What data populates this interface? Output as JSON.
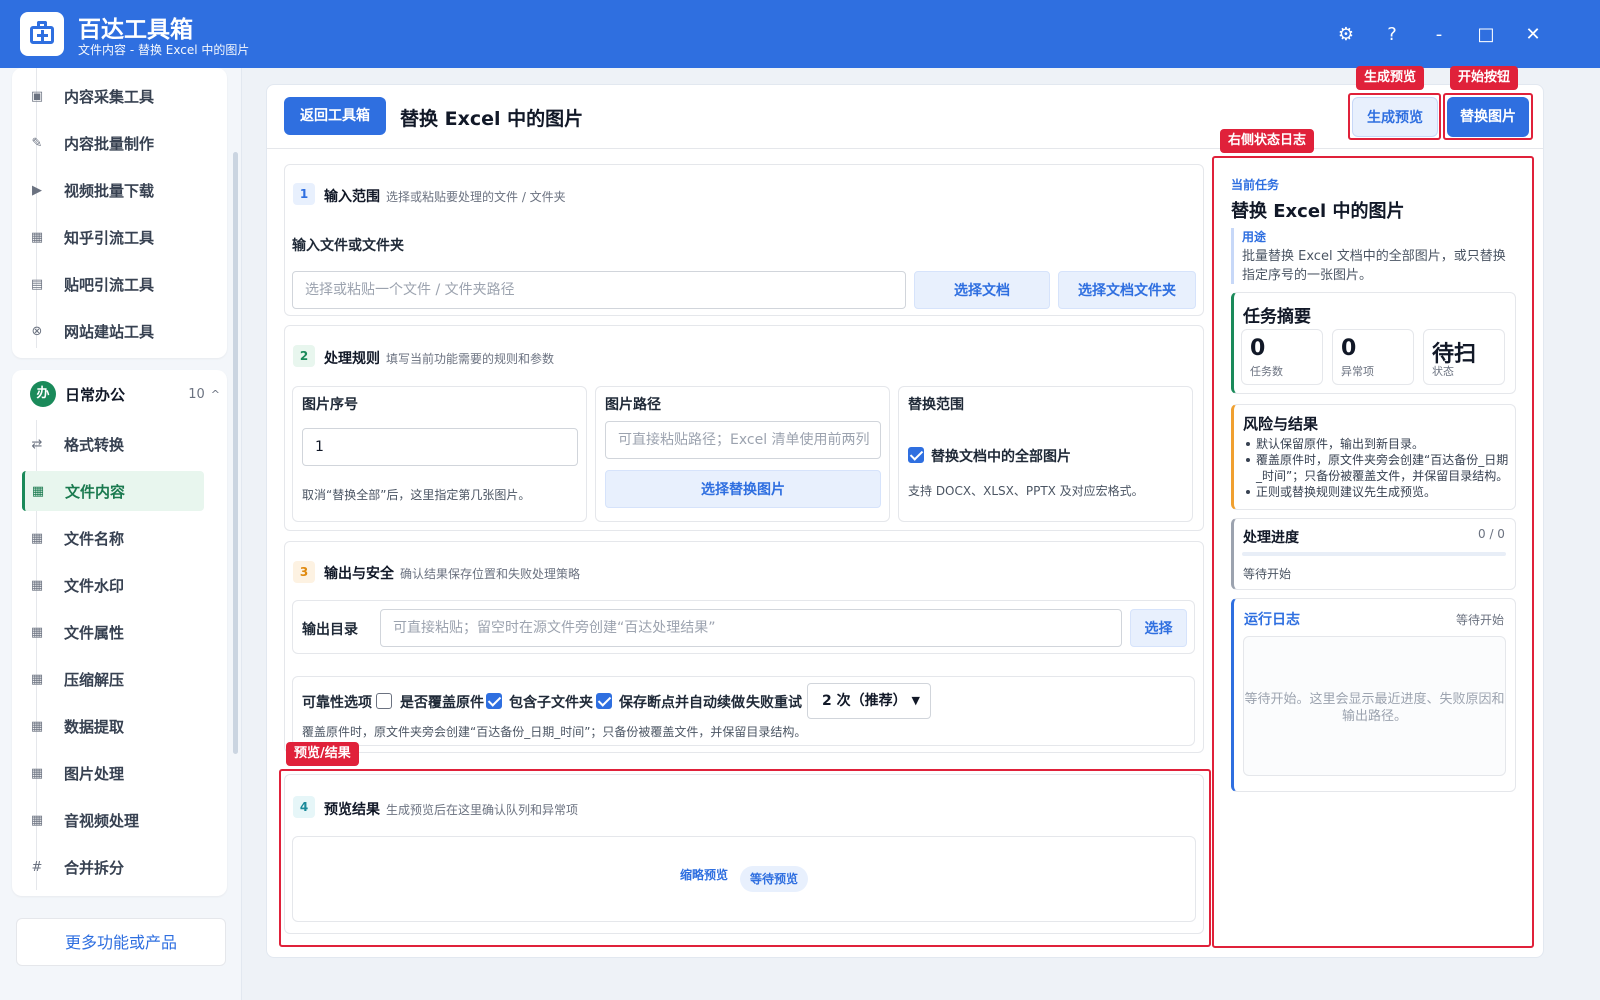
{
  "app": {
    "title": "百达工具箱",
    "subtitle": "文件内容 - 替换 Excel 中的图片",
    "window_buttons": {
      "settings": "⚙",
      "help": "?",
      "minimize": "-",
      "maximize": "□",
      "close": "✕"
    }
  },
  "sidebar": {
    "top_items": [
      {
        "label": "内容采集工具",
        "icon": "▣"
      },
      {
        "label": "内容批量制作",
        "icon": "✎"
      },
      {
        "label": "视频批量下载",
        "icon": "▶"
      },
      {
        "label": "知乎引流工具",
        "icon": "▦"
      },
      {
        "label": "贴吧引流工具",
        "icon": "▤"
      },
      {
        "label": "网站建站工具",
        "icon": "⊗"
      }
    ],
    "group": {
      "badge": "办",
      "name": "日常办公",
      "count": "10",
      "caret": "^"
    },
    "group_items": [
      {
        "label": "格式转换",
        "icon": "⇄"
      },
      {
        "label": "文件内容",
        "icon": "▦",
        "active": true
      },
      {
        "label": "文件名称",
        "icon": "▦"
      },
      {
        "label": "文件水印",
        "icon": "▦"
      },
      {
        "label": "文件属性",
        "icon": "▦"
      },
      {
        "label": "压缩解压",
        "icon": "▦"
      },
      {
        "label": "数据提取",
        "icon": "▦"
      },
      {
        "label": "图片处理",
        "icon": "▦"
      },
      {
        "label": "音视频处理",
        "icon": "▦"
      },
      {
        "label": "合并拆分",
        "icon": "#"
      }
    ],
    "more_label": "更多功能或产品"
  },
  "header": {
    "back_label": "返回工具箱",
    "title": "替换 Excel 中的图片",
    "preview_label": "生成预览",
    "start_label": "替换图片"
  },
  "section1": {
    "num": "1",
    "title": "输入范围",
    "desc": "选择或粘贴要处理的文件 / 文件夹",
    "field_label": "输入文件或文件夹",
    "placeholder": "选择或粘贴一个文件 / 文件夹路径",
    "btn_doc": "选择文档",
    "btn_folder": "选择文档文件夹"
  },
  "section2": {
    "num": "2",
    "title": "处理规则",
    "desc": "填写当前功能需要的规则和参数",
    "index_label": "图片序号",
    "index_value": "1",
    "index_hint": "取消“替换全部”后，这里指定第几张图片。",
    "path_label": "图片路径",
    "path_placeholder": "可直接粘贴路径；Excel 清单使用前两列",
    "path_button": "选择替换图片",
    "scope_label": "替换范围",
    "scope_checkbox": "替换文档中的全部图片",
    "scope_hint": "支持 DOCX、XLSX、PPTX 及对应宏格式。"
  },
  "section3": {
    "num": "3",
    "title": "输出与安全",
    "desc": "确认结果保存位置和失败处理策略",
    "output_label": "输出目录",
    "output_placeholder": "可直接粘贴；留空时在源文件旁创建“百达处理结果”",
    "output_button": "选择",
    "reliability_label": "可靠性选项",
    "opt_overwrite": "是否覆盖原件",
    "opt_subfolders": "包含子文件夹",
    "opt_resume": "保存断点并自动续做",
    "retry_label": "失败重试",
    "retry_value": "2 次（推荐）",
    "note": "覆盖原件时，原文件夹旁会创建“百达备份_日期_时间”；只备份被覆盖文件，并保留目录结构。"
  },
  "section4": {
    "num": "4",
    "title": "预览结果",
    "desc": "生成预览后在这里确认队列和异常项",
    "thumb_label": "缩略预览",
    "status_pill": "等待预览"
  },
  "right_panel": {
    "kicker": "当前任务",
    "title": "替换 Excel 中的图片",
    "use_label": "用途",
    "use_text": "批量替换 Excel 文档中的全部图片，或只替换指定序号的一张图片。",
    "summary_title": "任务摘要",
    "stats": [
      {
        "value": "0",
        "label": "任务数"
      },
      {
        "value": "0",
        "label": "异常项"
      },
      {
        "value": "待扫",
        "label": "状态"
      }
    ],
    "risk_title": "风险与结果",
    "risks": [
      "默认保留原件，输出到新目录。",
      "覆盖原件时，原文件夹旁会创建“百达备份_日期_时间”；只备份被覆盖文件，并保留目录结构。",
      "正则或替换规则建议先生成预览。"
    ],
    "progress_title": "处理进度",
    "progress_count": "0 / 0",
    "progress_fraction": 0,
    "progress_status": "等待开始",
    "log_title": "运行日志",
    "log_status": "等待开始",
    "log_placeholder": "等待开始。这里会显示最近进度、失败原因和输出路径。"
  },
  "annotations": {
    "preview_tag": "生成预览",
    "start_tag": "开始按钮",
    "log_tag": "右侧状态日志",
    "result_tag": "预览/结果"
  },
  "colors": {
    "brand": "#2f6fe0",
    "accent_green": "#1a8a5a",
    "annotation_red": "#e0213a",
    "warn_orange": "#f0a030"
  }
}
